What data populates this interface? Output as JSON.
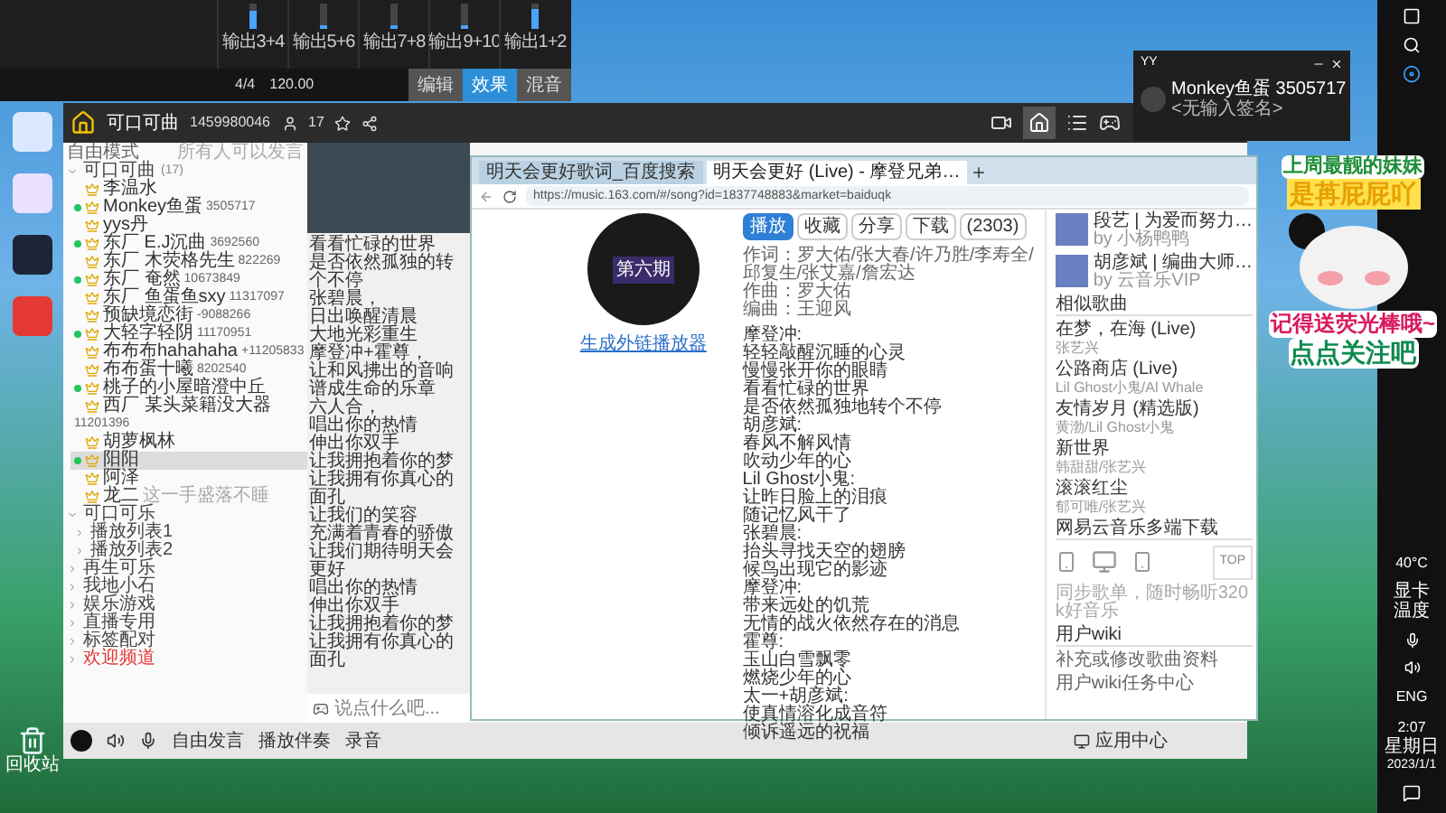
{
  "daw": {
    "channels": [
      {
        "label": "输出3+4",
        "level": 0.7
      },
      {
        "label": "输出5+6",
        "level": 0.15
      },
      {
        "label": "输出7+8",
        "level": 0.15
      },
      {
        "label": "输出9+10",
        "level": 0.15
      },
      {
        "label": "输出1+2",
        "level": 0.8
      }
    ],
    "meter": "4/4",
    "tempo": "120.00",
    "tabs": [
      {
        "label": "编辑",
        "selected": false
      },
      {
        "label": "效果",
        "selected": true
      },
      {
        "label": "混音",
        "selected": false
      }
    ]
  },
  "desktop": {
    "recycle_bin": "回收站"
  },
  "yy": {
    "channel_name": "可口可曲",
    "channel_id": "1459980046",
    "online": "17",
    "mode": "自由模式",
    "speak_rule": "所有人可以发言",
    "tree": [
      {
        "kind": "channel",
        "label": "可口可曲",
        "count": "(17)",
        "expanded": true,
        "highlighted": false,
        "children": [
          {
            "kind": "user",
            "name": "李温水",
            "online": false,
            "selected": false
          },
          {
            "kind": "user",
            "name": "Monkey鱼蛋",
            "id": "3505717",
            "online": true,
            "selected": false
          },
          {
            "kind": "user",
            "name": "yys丹",
            "online": false,
            "selected": false
          },
          {
            "kind": "user",
            "name": "东厂 E.J沉曲",
            "id": "3692560",
            "online": true,
            "selected": false
          },
          {
            "kind": "user",
            "name": "东厂 木荧格先生",
            "id": "822269",
            "online": false,
            "selected": false
          },
          {
            "kind": "user",
            "name": "东厂 奄然",
            "id": "10673849",
            "online": true,
            "selected": false
          },
          {
            "kind": "user",
            "name": "东厂 鱼蛋鱼sxy",
            "id": "11317097",
            "online": false,
            "selected": false
          },
          {
            "kind": "user",
            "name": "预缺境恋街",
            "id": "-9088266",
            "online": false,
            "selected": false
          },
          {
            "kind": "user",
            "name": "大轻字轻阴",
            "id": "11170951",
            "online": true,
            "selected": false
          },
          {
            "kind": "user",
            "name": "布布布hahahaha",
            "id": "+11205833",
            "online": false,
            "selected": false
          },
          {
            "kind": "user",
            "name": "布布蛋十曦",
            "id": "8202540",
            "online": false,
            "selected": false
          },
          {
            "kind": "user",
            "name": "桃子的小屋暗澄中丘",
            "online": true,
            "selected": false
          },
          {
            "kind": "user",
            "name": "西厂 某头菜籍没大器",
            "id": "11201396",
            "online": false,
            "selected": false
          },
          {
            "kind": "user",
            "name": "胡萝枫林",
            "online": false,
            "selected": false
          },
          {
            "kind": "user",
            "name": "阳阳",
            "online": true,
            "selected": true
          },
          {
            "kind": "user",
            "name": "阿泽",
            "online": false,
            "selected": false
          },
          {
            "kind": "user",
            "name": "龙二",
            "status": "这一手盛落不睡",
            "online": false,
            "selected": false
          }
        ]
      },
      {
        "kind": "channel",
        "label": "可口可乐",
        "expanded": true,
        "highlighted": false,
        "children": [
          {
            "kind": "channel",
            "label": "播放列表1",
            "expanded": false,
            "highlighted": false
          },
          {
            "kind": "channel",
            "label": "播放列表2",
            "expanded": false,
            "highlighted": false
          }
        ]
      },
      {
        "kind": "channel",
        "label": "再生可乐",
        "expanded": false,
        "highlighted": false
      },
      {
        "kind": "channel",
        "label": "我地小石",
        "expanded": false,
        "highlighted": false
      },
      {
        "kind": "channel",
        "label": "娱乐游戏",
        "expanded": false,
        "highlighted": false
      },
      {
        "kind": "channel",
        "label": "直播专用",
        "expanded": false,
        "highlighted": false
      },
      {
        "kind": "channel",
        "label": "标签配对",
        "expanded": false,
        "highlighted": false
      },
      {
        "kind": "channel",
        "label": "欢迎频道",
        "expanded": false,
        "highlighted": true
      }
    ],
    "chat_lines": [
      "看看忙碌的世界",
      "是否依然孤独的转个不停",
      "张碧晨，",
      "日出唤醒清晨",
      "大地光彩重生",
      "摩登冲+霍尊，",
      "让和风拂出的音响",
      "谱成生命的乐章",
      "六人合，",
      "唱出你的热情",
      "伸出你双手",
      "让我拥抱着你的梦",
      "让我拥有你真心的面孔",
      "让我们的笑容",
      "充满着青春的骄傲",
      "让我们期待明天会更好",
      "唱出你的热情",
      "伸出你双手",
      "让我拥抱着你的梦",
      "让我拥有你真心的面孔"
    ],
    "chat_input": {
      "placeholder": "说点什么吧..."
    },
    "bottom_buttons": [
      "自由发言",
      "播放伴奏",
      "录音"
    ],
    "status_bar": "应用中心"
  },
  "browser": {
    "tabs": [
      {
        "title": "明天会更好歌词_百度搜索",
        "selected": false
      },
      {
        "title": "明天会更好 (Live) - 摩登兄弟…",
        "selected": true
      }
    ],
    "url": "https://music.163.com/#/song?id=1837748883&market=baiduqk",
    "album_label": "第六期",
    "player_link": "生成外链播放器",
    "actions": [
      "播放",
      "收藏",
      "分享",
      "下载",
      "(2303)"
    ],
    "credits": [
      "作词：罗大佑/张大春/许乃胜/李寿全/邱复生/张艾嘉/詹宏达",
      "作曲：罗大佑",
      "编曲：王迎风"
    ],
    "lyrics": [
      "摩登冲:",
      "轻轻敲醒沉睡的心灵",
      "慢慢张开你的眼睛",
      "看看忙碌的世界",
      "是否依然孤独地转个不停",
      "胡彦斌:",
      "春风不解风情",
      "吹动少年的心",
      "Lil Ghost小鬼:",
      "让昨日脸上的泪痕",
      "随记忆风干了",
      "张碧晨:",
      "抬头寻找天空的翅膀",
      "候鸟出现它的影迹",
      "摩登冲:",
      "带来远处的饥荒",
      "无情的战火依然存在的消息",
      "霍尊:",
      "玉山白雪飘零",
      "燃烧少年的心",
      "太一+胡彦斌:",
      "使真情溶化成音符",
      "倾诉遥远的祝福"
    ],
    "playlists": [
      {
        "title": "段艺 | 为爱而努力…",
        "by": "by 小杨鸭鸭"
      },
      {
        "title": "胡彦斌 | 编曲大师…",
        "by": "by 云音乐VIP"
      }
    ],
    "similar_title": "相似歌曲",
    "similar": [
      {
        "title": "在梦，在海 (Live)",
        "artist": "张艺兴"
      },
      {
        "title": "公路商店 (Live)",
        "artist": "Lil Ghost小鬼/Al Whale"
      },
      {
        "title": "友情岁月 (精选版)",
        "artist": "黄渤/Lil Ghost小鬼"
      },
      {
        "title": "新世界",
        "artist": "韩甜甜/张艺兴"
      },
      {
        "title": "滚滚红尘",
        "artist": "郁可唯/张艺兴"
      }
    ],
    "download_title": "网易云音乐多端下载",
    "download_note": "同步歌单，随时畅听320k好音乐",
    "wiki_title": "用户wiki",
    "wiki_links": [
      "补充或修改歌曲资料",
      "用户wiki任务中心"
    ],
    "top_button": "TOP"
  },
  "yy_mini": {
    "title": "YY",
    "name": "Monkey鱼蛋 3505717",
    "signature": "<无输入签名>"
  },
  "overlay": {
    "lines": [
      "上周最靓的妹妹",
      "是苒屁屁吖",
      "记得送荧光棒哦~",
      "点点关注吧"
    ]
  },
  "taskbar": {
    "temp": "40°C",
    "temp_label": "显卡温度",
    "lang": "ENG",
    "time": "2:07",
    "weekday": "星期日",
    "date": "2023/1/1"
  }
}
